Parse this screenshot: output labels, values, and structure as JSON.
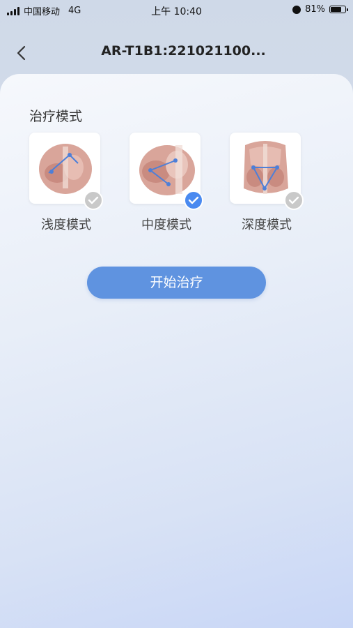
{
  "status_bar": {
    "carrier": "中国移动",
    "network": "4G",
    "time": "上午 10:40",
    "battery": "81%",
    "battery_level": 0.81
  },
  "nav": {
    "title": "AR-T1B1:221021100..."
  },
  "section": {
    "title": "治疗模式"
  },
  "modes": [
    {
      "label": "浅度模式",
      "selected": false
    },
    {
      "label": "中度模式",
      "selected": true
    },
    {
      "label": "深度模式",
      "selected": false
    }
  ],
  "start_button": {
    "label": "开始治疗"
  },
  "colors": {
    "accent": "#4a8af0",
    "button": "#5f93e0",
    "check_off": "#c9c9c9"
  }
}
